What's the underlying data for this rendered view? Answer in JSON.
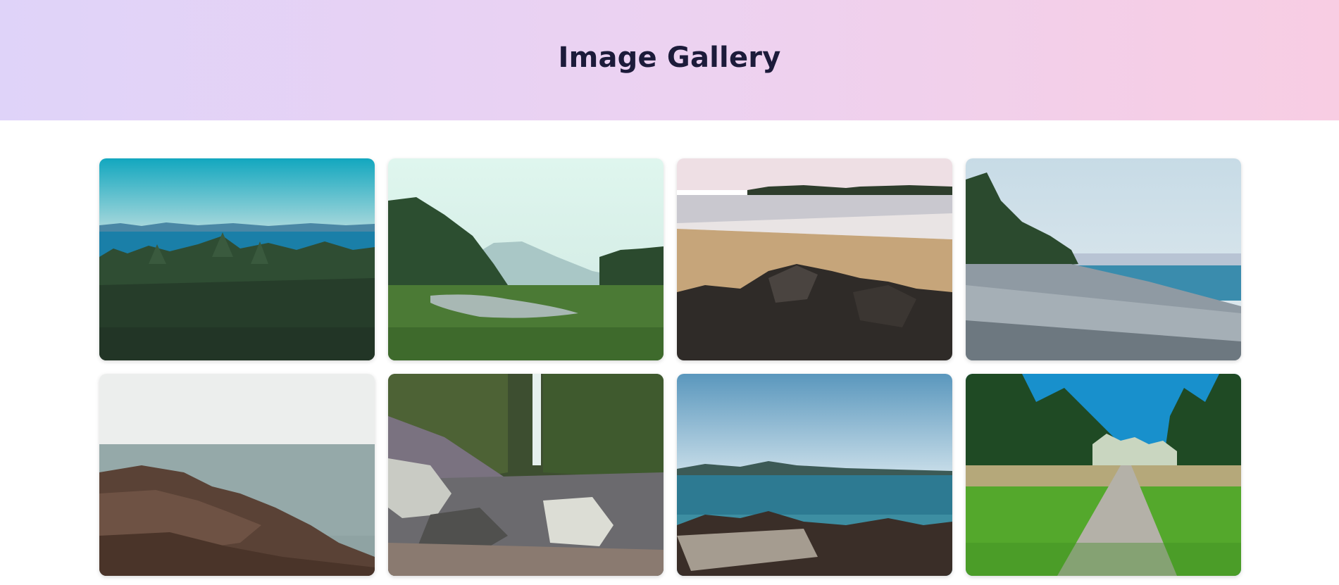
{
  "header": {
    "title": "Image Gallery"
  },
  "gallery": {
    "items": [
      {
        "name": "gallery-image-forest-sea-view"
      },
      {
        "name": "gallery-image-valley-stream"
      },
      {
        "name": "gallery-image-rocky-beach"
      },
      {
        "name": "gallery-image-pebble-shore"
      },
      {
        "name": "gallery-image-rocky-coast"
      },
      {
        "name": "gallery-image-waterfall-canyon"
      },
      {
        "name": "gallery-image-ocean-driftwood"
      },
      {
        "name": "gallery-image-meadow-path"
      }
    ]
  }
}
